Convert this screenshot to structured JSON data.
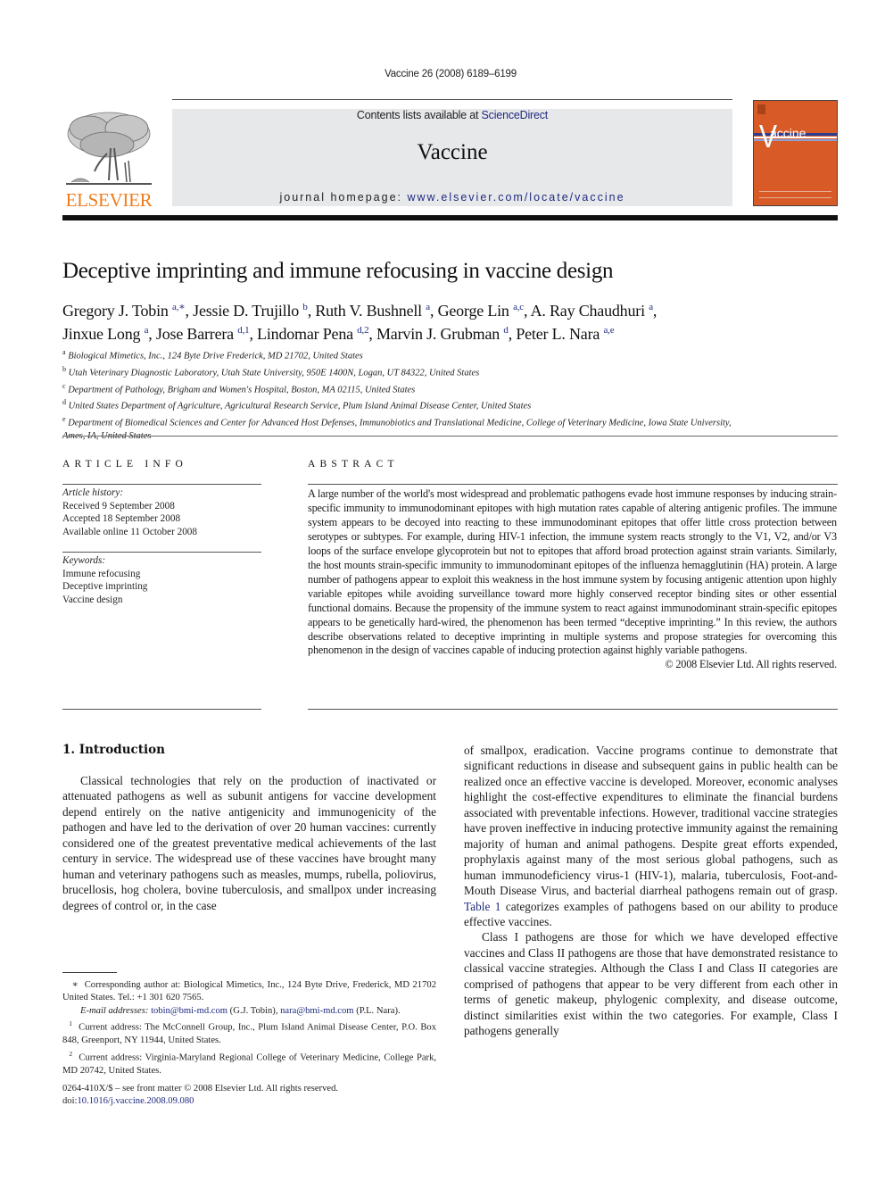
{
  "running_header": "Vaccine 26 (2008) 6189–6199",
  "publisher": {
    "name": "ELSEVIER",
    "logo_icon": "elsevier-tree-logo",
    "brand_color": "#f07c1e"
  },
  "masthead": {
    "contents_prefix": "Contents lists available at ",
    "contents_link": "ScienceDirect",
    "journal_title": "Vaccine",
    "homepage_prefix": "journal homepage: ",
    "homepage_link": "www.elsevier.com/locate/vaccine",
    "background_color": "#e7e8ea",
    "cover": {
      "title": "accine",
      "title_initial": "V",
      "color": "#d85a27"
    }
  },
  "article": {
    "title": "Deceptive imprinting and immune refocusing in vaccine design",
    "authors": [
      {
        "name": "Gregory J. Tobin",
        "sup": "a,∗",
        "sep": ", "
      },
      {
        "name": "Jessie D. Trujillo",
        "sup": "b",
        "sep": ", "
      },
      {
        "name": "Ruth V. Bushnell",
        "sup": "a",
        "sep": ", "
      },
      {
        "name": "George Lin",
        "sup": "a,c",
        "sep": ", "
      },
      {
        "name": "A. Ray Chaudhuri",
        "sup": "a",
        "sep": ","
      },
      {
        "name": "Jinxue Long",
        "sup": "a",
        "sep": ", "
      },
      {
        "name": "Jose Barrera",
        "sup": "d,1",
        "sep": ", "
      },
      {
        "name": "Lindomar Pena",
        "sup": "d,2",
        "sep": ", "
      },
      {
        "name": "Marvin J. Grubman",
        "sup": "d",
        "sep": ", "
      },
      {
        "name": "Peter L. Nara",
        "sup": "a,e",
        "sep": ""
      }
    ],
    "affiliations": [
      {
        "key": "a",
        "text": "Biological Mimetics, Inc., 124 Byte Drive Frederick, MD 21702, United States"
      },
      {
        "key": "b",
        "text": "Utah Veterinary Diagnostic Laboratory, Utah State University, 950E 1400N, Logan, UT 84322, United States"
      },
      {
        "key": "c",
        "text": "Department of Pathology, Brigham and Women's Hospital, Boston, MA 02115, United States"
      },
      {
        "key": "d",
        "text": "United States Department of Agriculture, Agricultural Research Service, Plum Island Animal Disease Center, United States"
      },
      {
        "key": "e",
        "text": "Department of Biomedical Sciences and Center for Advanced Host Defenses, Immunobiotics and Translational Medicine, College of Veterinary Medicine, Iowa State University, Ames, IA, United States"
      }
    ]
  },
  "article_info": {
    "heading": "ARTICLE  INFO",
    "history_label": "Article history:",
    "history": [
      "Received 9 September 2008",
      "Accepted 18 September 2008",
      "Available online 11 October 2008"
    ],
    "keywords_label": "Keywords:",
    "keywords": [
      "Immune refocusing",
      "Deceptive imprinting",
      "Vaccine design"
    ]
  },
  "abstract": {
    "heading": "ABSTRACT",
    "text": "A large number of the world's most widespread and problematic pathogens evade host immune responses by inducing strain-specific immunity to immunodominant epitopes with high mutation rates capable of altering antigenic profiles. The immune system appears to be decoyed into reacting to these immunodominant epitopes that offer little cross protection between serotypes or subtypes. For example, during HIV-1 infection, the immune system reacts strongly to the V1, V2, and/or V3 loops of the surface envelope glycoprotein but not to epitopes that afford broad protection against strain variants. Similarly, the host mounts strain-specific immunity to immunodominant epitopes of the influenza hemagglutinin (HA) protein. A large number of pathogens appear to exploit this weakness in the host immune system by focusing antigenic attention upon highly variable epitopes while avoiding surveillance toward more highly conserved receptor binding sites or other essential functional domains. Because the propensity of the immune system to react against immunodominant strain-specific epitopes appears to be genetically hard-wired, the phenomenon has been termed “deceptive imprinting.” In this review, the authors describe observations related to deceptive imprinting in multiple systems and propose strategies for overcoming this phenomenon in the design of vaccines capable of inducing protection against highly variable pathogens.",
    "copyright": "© 2008 Elsevier Ltd. All rights reserved."
  },
  "body": {
    "section_title": "1.  Introduction",
    "col1_para1": "Classical technologies that rely on the production of inactivated or attenuated pathogens as well as subunit antigens for vaccine development depend entirely on the native antigenicity and immunogenicity of the pathogen and have led to the derivation of over 20 human vaccines: currently considered one of the greatest preventative medical achievements of the last century in service. The widespread use of these vaccines have brought many human and veterinary pathogens such as measles, mumps, rubella, poliovirus, brucellosis, hog cholera, bovine tuberculosis, and smallpox under increasing degrees of control or, in the case",
    "col2_para1_before_link": "of smallpox, eradication. Vaccine programs continue to demonstrate that significant reductions in disease and subsequent gains in public health can be realized once an effective vaccine is developed. Moreover, economic analyses highlight the cost-effective expenditures to eliminate the financial burdens associated with preventable infections. However, traditional vaccine strategies have proven ineffective in inducing protective immunity against the remaining majority of human and animal pathogens. Despite great efforts expended, prophylaxis against many of the most serious global pathogens, such as human immunodeficiency virus-1 (HIV-1), malaria, tuberculosis, Foot-and-Mouth Disease Virus, and bacterial diarrheal pathogens remain out of grasp. ",
    "col2_table_link": "Table 1",
    "col2_para1_after_link": " categorizes examples of pathogens based on our ability to produce effective vaccines.",
    "col2_para2": "Class I pathogens are those for which we have developed effective vaccines and Class II pathogens are those that have demonstrated resistance to classical vaccine strategies. Although the Class I and Class II categories are comprised of pathogens that appear to be very different from each other in terms of genetic makeup, phylogenic complexity, and disease outcome, distinct similarities exist within the two categories. For example, Class I pathogens generally"
  },
  "footnotes": {
    "corresponding_mark": "∗",
    "corresponding": "Corresponding author at: Biological Mimetics, Inc., 124 Byte Drive, Frederick, MD 21702 United States. Tel.: +1 301 620 7565.",
    "email_label": "E-mail addresses: ",
    "email1": "tobin@bmi-md.com",
    "email1_owner": " (G.J. Tobin), ",
    "email2": "nara@bmi-md.com",
    "email2_owner": " (P.L. Nara).",
    "fn1_mark": "1",
    "fn1": "Current address: The McConnell Group, Inc., Plum Island Animal Disease Center, P.O. Box 848, Greenport, NY 11944, United States.",
    "fn2_mark": "2",
    "fn2": "Current address: Virginia-Maryland Regional College of Veterinary Medicine, College Park, MD 20742, United States."
  },
  "front_matter": {
    "issn_line": "0264-410X/$ – see front matter © 2008 Elsevier Ltd. All rights reserved.",
    "doi_label": "doi:",
    "doi": "10.1016/j.vaccine.2008.09.080"
  }
}
